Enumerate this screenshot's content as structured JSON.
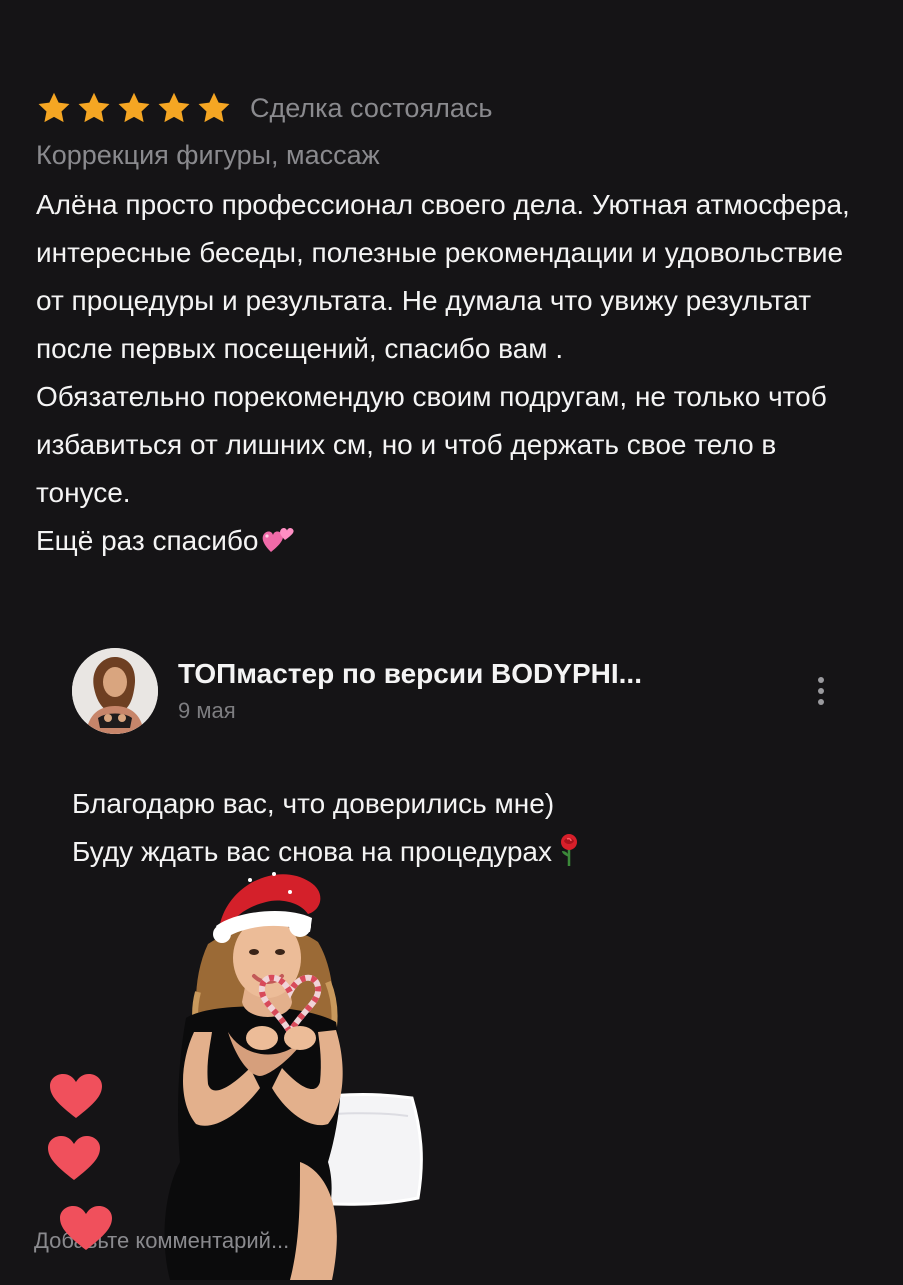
{
  "review": {
    "rating": 5,
    "rating_max": 5,
    "star_color": "#F5A623",
    "deal_status": "Сделка состоялась",
    "category": "Коррекция фигуры, массаж",
    "text_lines": [
      "Алёна просто профессионал своего дела. Уютная атмосфера, интересные беседы, полезные рекомендации и удовольствие от процедуры и результата. Не думала что увижу результат после первых посещений, спасибо вам .",
      "Обязательно порекомендую своим подругам, не только чтоб избавиться от лишних см, но и чтоб держать свое тело в тонусе.",
      "Ещё раз спасибо"
    ],
    "trailing_emoji": "two-hearts-icon"
  },
  "reply": {
    "author": "ТОПмастер по версии BODYPHI...",
    "date": "9 мая",
    "text_lines": [
      "Благодарю вас, что доверились мне)",
      "Буду ждать вас снова на процедурах"
    ],
    "trailing_emoji": "rose-icon"
  },
  "comment_input": {
    "placeholder": "Добавьте комментарий..."
  },
  "colors": {
    "background": "#151416",
    "heart": "#F0505C",
    "muted_text": "#8A8A8E"
  }
}
